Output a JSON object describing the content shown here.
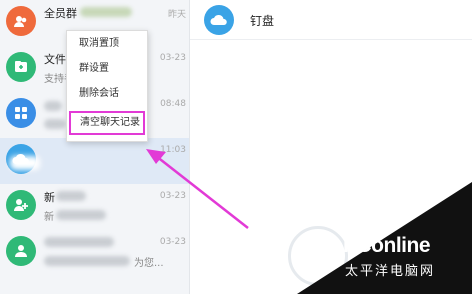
{
  "conversations": [
    {
      "title": "全员群",
      "subtitle": "",
      "time": "昨天",
      "avatar_color": "#ef6a3c",
      "icon": "group-icon"
    },
    {
      "title": "文件小",
      "subtitle": "支持手",
      "time": "03-23",
      "avatar_color": "#2fb977",
      "icon": "file-icon"
    },
    {
      "title": "",
      "subtitle": "",
      "time": "08:48",
      "avatar_color": "#3a8ee6",
      "icon": "apps-grid-icon"
    },
    {
      "title": "",
      "subtitle": "",
      "time": "11:03",
      "avatar_color": "#3aa3e6",
      "icon": "cloud-icon"
    },
    {
      "title": "新",
      "subtitle": "新",
      "time": "03-23",
      "avatar_color": "#2fb977",
      "icon": "add-user-icon"
    },
    {
      "title": "",
      "subtitle": "为您...",
      "time": "03-23",
      "avatar_color": "#2fb977",
      "icon": "team-icon"
    }
  ],
  "main": {
    "title": "钉盘",
    "icon": "cloud-icon",
    "accent": "#3aa3e6"
  },
  "context_menu": {
    "items": [
      "取消置顶",
      "群设置",
      "删除会话",
      "清空聊天记录"
    ],
    "highlighted_index": 3,
    "highlight_color": "#e23ad6"
  },
  "watermark": {
    "brand": "PConline",
    "sub": "太平洋电脑网"
  }
}
